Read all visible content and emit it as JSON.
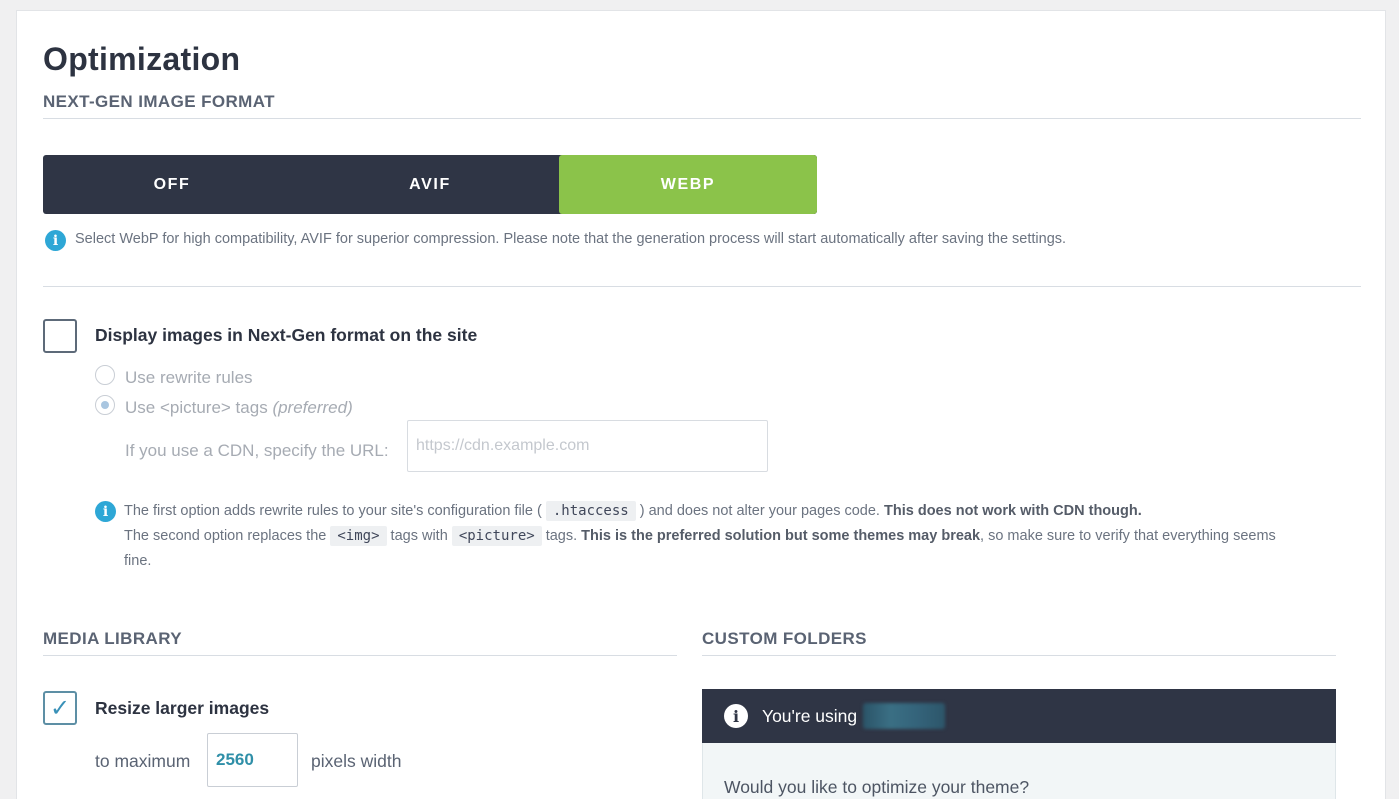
{
  "page": {
    "title": "Optimization"
  },
  "next_gen": {
    "section_title": "NEXT-GEN IMAGE FORMAT",
    "options": [
      "OFF",
      "AVIF",
      "WEBP"
    ],
    "selected": "WEBP",
    "active_color": "#8bc34a",
    "note": "Select WebP for high compatibility, AVIF for superior compression. Please note that the generation process will start automatically after saving the settings."
  },
  "display_nextgen": {
    "checkbox_label": "Display images in Next-Gen format on the site",
    "checked": false,
    "radio_rewrite": "Use rewrite rules",
    "radio_picture": "Use <picture> tags",
    "radio_picture_suffix": "(preferred)",
    "cdn_label": "If you use a CDN, specify the URL:",
    "cdn_placeholder": "https://cdn.example.com",
    "explain": {
      "line1_a": "The first option adds rewrite rules to your site's configuration file (",
      "htaccess": ".htaccess",
      "line1_b": ") and does not alter your pages code.",
      "line1_bold": "This does not work with CDN though.",
      "line2_a": "The second option replaces the",
      "img_tag": "<img>",
      "line2_b": "tags with",
      "picture_tag": "<picture>",
      "line2_c": "tags.",
      "line2_bold": "This is the preferred solution but some themes may break",
      "line2_d": ", so make sure to verify that everything seems",
      "line3": "fine."
    }
  },
  "media_library": {
    "section_title": "MEDIA LIBRARY",
    "resize_label": "Resize larger images",
    "resize_checked": true,
    "to_maximum": "to maximum",
    "max_width": "2560",
    "pixels_width": "pixels width"
  },
  "custom_folders": {
    "section_title": "CUSTOM FOLDERS",
    "banner_text": "You're using",
    "question": "Would you like to optimize your theme?"
  },
  "icons": {
    "info": "info-icon",
    "check": "check-icon"
  }
}
